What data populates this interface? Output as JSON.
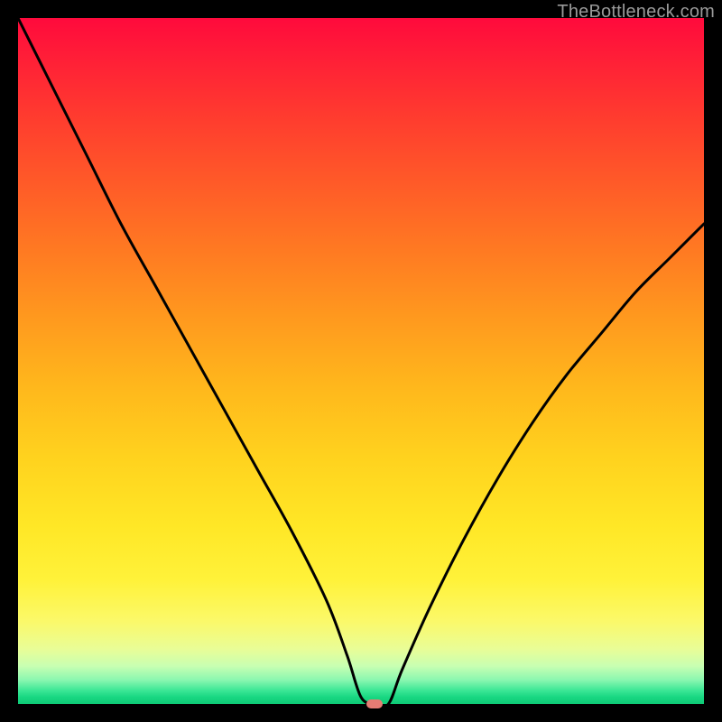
{
  "domain": "Chart",
  "watermark": "TheBottleneck.com",
  "chart_data": {
    "type": "line",
    "title": "",
    "xlabel": "",
    "ylabel": "",
    "xlim": [
      0,
      100
    ],
    "ylim": [
      0,
      100
    ],
    "grid": false,
    "marker": {
      "x": 52,
      "y": 0
    },
    "series": [
      {
        "name": "curve",
        "x": [
          0,
          5,
          10,
          15,
          20,
          25,
          30,
          35,
          40,
          45,
          48,
          50,
          52,
          54,
          56,
          60,
          65,
          70,
          75,
          80,
          85,
          90,
          95,
          100
        ],
        "y": [
          100,
          90,
          80,
          70,
          61,
          52,
          43,
          34,
          25,
          15,
          7,
          1,
          0,
          0,
          5,
          14,
          24,
          33,
          41,
          48,
          54,
          60,
          65,
          70
        ]
      }
    ],
    "background_gradient": {
      "top": "#ff0a3c",
      "mid_upper": "#ff9a1e",
      "mid_lower": "#fff23a",
      "bottom": "#0eca76"
    }
  }
}
